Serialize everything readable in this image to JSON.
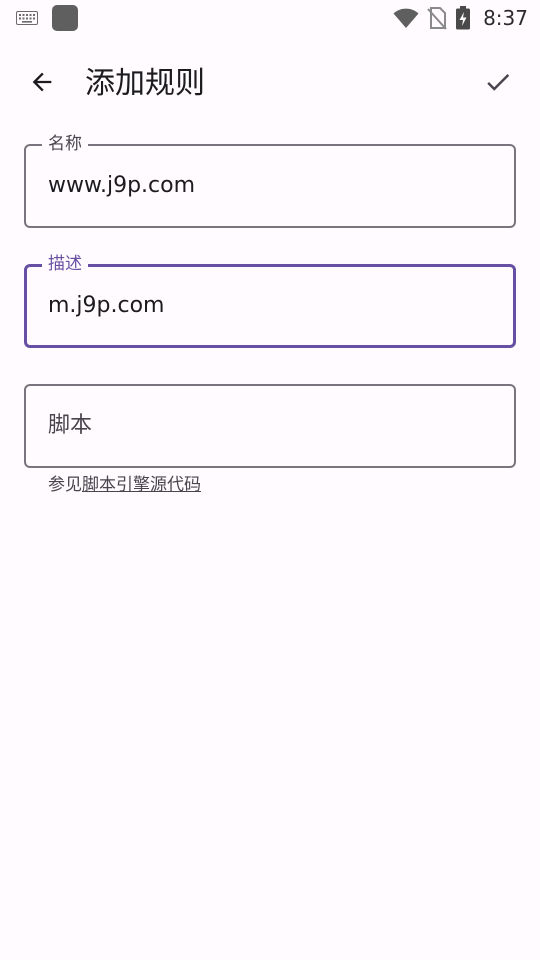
{
  "status_bar": {
    "time": "8:37",
    "icons": [
      "keyboard-icon",
      "app-notification-icon",
      "wifi-icon",
      "no-sim-icon",
      "battery-charging-icon"
    ]
  },
  "app_bar": {
    "title": "添加规则",
    "back_icon": "arrow-back-icon",
    "confirm_icon": "check-icon"
  },
  "form": {
    "name": {
      "label": "名称",
      "value": "www.j9p.com"
    },
    "description": {
      "label": "描述",
      "value": "m.j9p.com",
      "focused": true
    },
    "script": {
      "placeholder": "脚本",
      "value": ""
    },
    "helper": {
      "prefix": "参见",
      "link_text": "脚本引擎源代码"
    }
  },
  "colors": {
    "background": "#fffbfe",
    "primary": "#6750a4",
    "outline": "#79747e",
    "on_surface": "#1c1b1f",
    "on_surface_variant": "#49454f"
  }
}
